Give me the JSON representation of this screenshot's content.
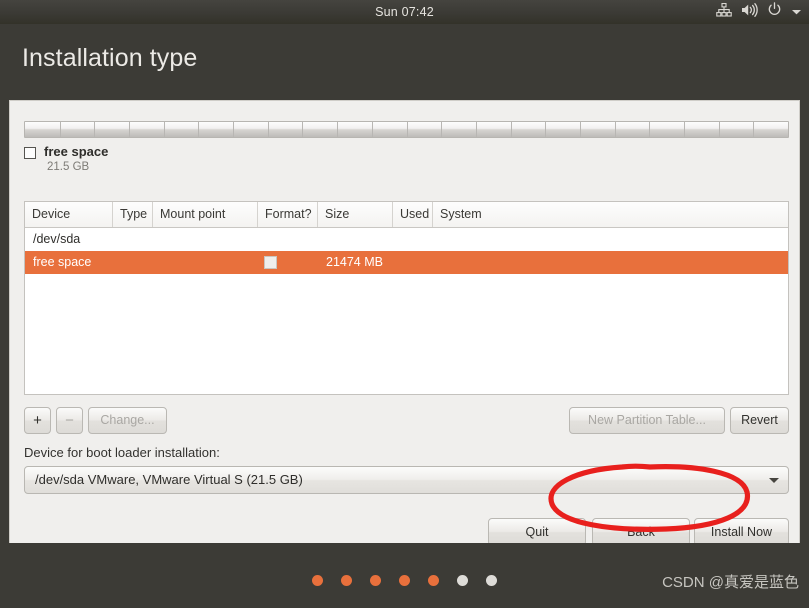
{
  "top_panel": {
    "clock": "Sun 07:42",
    "tray_icons": [
      "network-icon",
      "volume-icon",
      "power-icon",
      "chevron-down-icon"
    ]
  },
  "window": {
    "title": "Installation type"
  },
  "disk_bar": {
    "segments": 22
  },
  "legend": {
    "name": "free space",
    "size": "21.5 GB"
  },
  "table": {
    "columns": [
      "Device",
      "Type",
      "Mount point",
      "Format?",
      "Size",
      "Used",
      "System"
    ],
    "rows": [
      {
        "type": "device",
        "device": "/dev/sda",
        "type_col": "",
        "mount_point": "",
        "format": "",
        "size": "",
        "used": "",
        "system": "",
        "selected": false,
        "has_checkbox": false
      },
      {
        "type": "partition",
        "device": "free space",
        "type_col": "",
        "mount_point": "",
        "format": "",
        "size": "21474 MB",
        "used": "",
        "system": "",
        "selected": true,
        "has_checkbox": true
      }
    ]
  },
  "partition_tools": {
    "add_label": "+",
    "remove_label": "−",
    "change_label": "Change...",
    "new_partition_table_label": "New Partition Table...",
    "revert_label": "Revert",
    "add_enabled": true,
    "remove_enabled": false,
    "change_enabled": false,
    "new_partition_table_enabled": false,
    "revert_enabled": true
  },
  "bootloader": {
    "label": "Device for boot loader installation:",
    "value": "/dev/sda VMware, VMware Virtual S (21.5 GB)"
  },
  "footer": {
    "quit_label": "Quit",
    "back_label": "Back",
    "install_label": "Install Now"
  },
  "progress_dots": {
    "total": 7,
    "filled": 5,
    "filled_color": "#e8703c",
    "empty_color": "#dedcd8"
  },
  "watermark": {
    "text": "CSDN @真爱是蓝色"
  },
  "colors": {
    "accent_orange": "#e8703c",
    "panel_dark": "#3c3b36",
    "content_bg": "#f0efed",
    "annotation_red": "#e8201d"
  }
}
